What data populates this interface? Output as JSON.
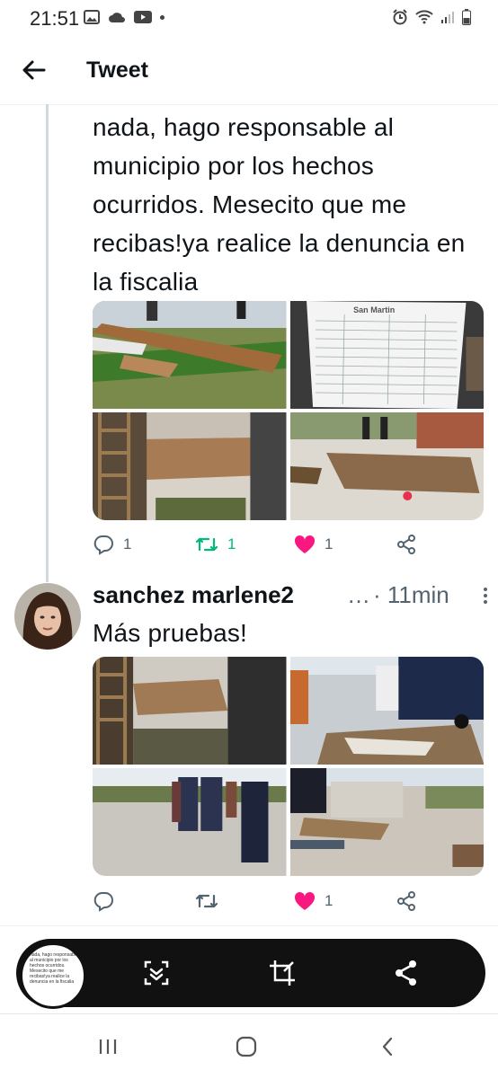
{
  "status_bar": {
    "time": "21:51"
  },
  "header": {
    "title": "Tweet"
  },
  "tweet1": {
    "text": "nada, hago responsable al municipio por los hechos ocurridos. Mesecito que me recibas!ya realice la denuncia en la fiscalia",
    "photo_paper_heading": "San Martin",
    "replies": "1",
    "retweets": "1",
    "likes": "1"
  },
  "tweet2": {
    "author": "sanchez marlene2",
    "truncation": "…",
    "meta": "· 11min",
    "text": "Más pruebas!",
    "likes": "1"
  },
  "screenshot_toolbar": {
    "thumbnail_text": "nada, hago responsable al municipio por los hechos ocurridos. Mesecito que me recibas!ya realice la denuncia en la fiscalia"
  },
  "colors": {
    "like": "#f91880",
    "retweet": "#00ba7c",
    "secondary": "#536471"
  }
}
